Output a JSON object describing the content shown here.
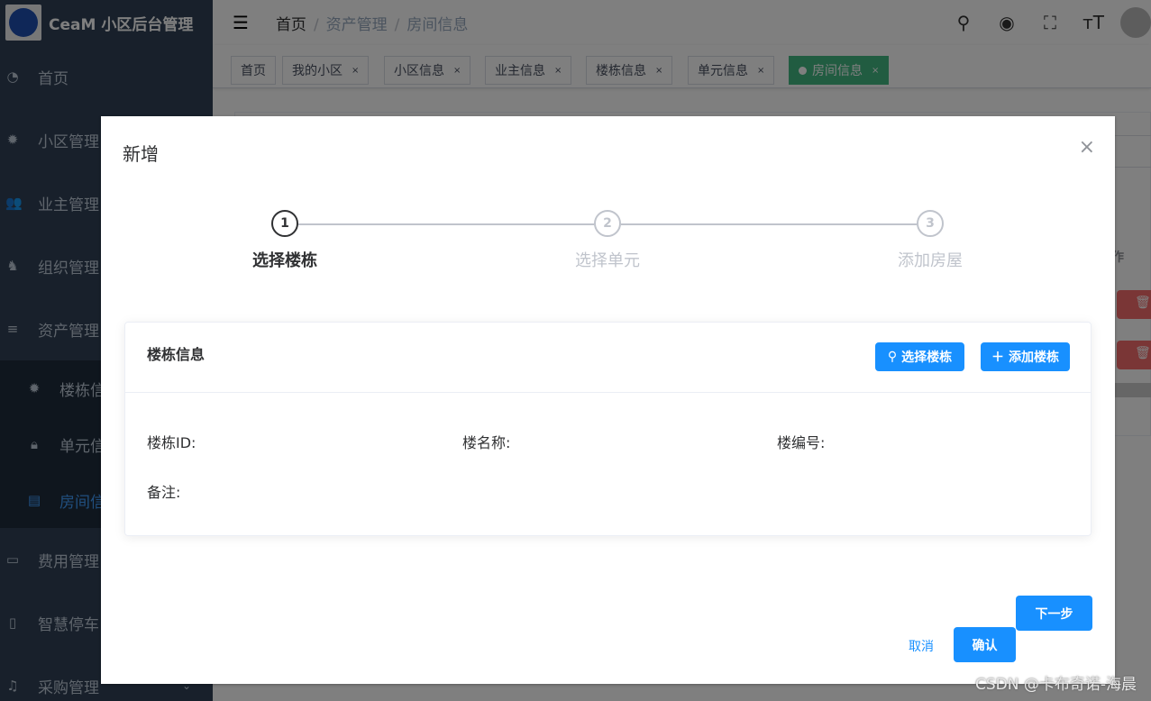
{
  "app": {
    "title": "CeaM 小区后台管理"
  },
  "sidebar": {
    "items": [
      {
        "label": "首页",
        "icon": "dashboard-icon"
      },
      {
        "label": "小区管理",
        "icon": "gear-icon"
      },
      {
        "label": "业主管理",
        "icon": "users-icon"
      },
      {
        "label": "组织管理",
        "icon": "organization-icon"
      },
      {
        "label": "资产管理",
        "icon": "list-icon"
      }
    ],
    "sub": [
      {
        "label": "楼栋信息",
        "icon": "gear-icon"
      },
      {
        "label": "单元信息",
        "icon": "lock-icon"
      },
      {
        "label": "房间信息",
        "icon": "document-icon"
      }
    ],
    "more": [
      {
        "label": "费用管理",
        "icon": "monitor-icon"
      },
      {
        "label": "智慧停车",
        "icon": "parking-icon"
      },
      {
        "label": "采购管理",
        "icon": "bell-icon"
      }
    ]
  },
  "breadcrumb": [
    "首页",
    "资产管理",
    "房间信息"
  ],
  "tags": [
    {
      "label": "首页"
    },
    {
      "label": "我的小区"
    },
    {
      "label": "小区信息"
    },
    {
      "label": "业主信息"
    },
    {
      "label": "楼栋信息"
    },
    {
      "label": "单元信息"
    },
    {
      "label": "房间信息"
    }
  ],
  "tag_close": "×",
  "table": {
    "col_partial": "作"
  },
  "modal": {
    "title": "新增",
    "close": "×",
    "steps": [
      {
        "num": "1",
        "label": "选择楼栋"
      },
      {
        "num": "2",
        "label": "选择单元"
      },
      {
        "num": "3",
        "label": "添加房屋"
      }
    ],
    "card": {
      "title": "楼栋信息",
      "select_btn": "选择楼栋",
      "add_btn": "添加楼栋",
      "fields": {
        "id": "楼栋ID:",
        "name": "楼名称:",
        "code": "楼编号:",
        "remark": "备注:"
      }
    },
    "next": "下一步",
    "cancel": "取消",
    "confirm": "确认"
  },
  "watermark": "CSDN @卡布奇诺-海晨"
}
